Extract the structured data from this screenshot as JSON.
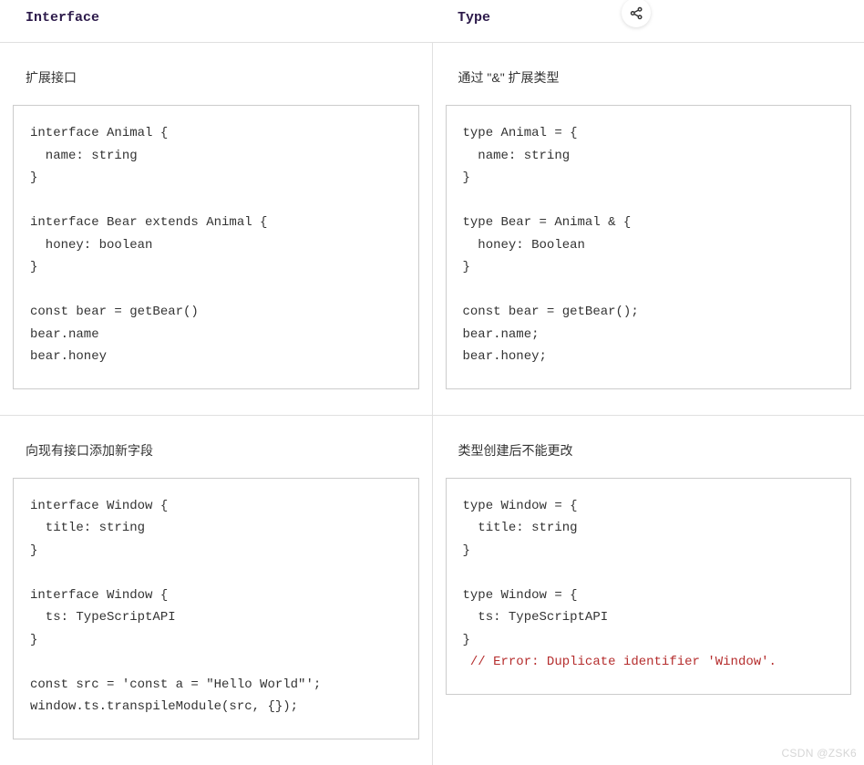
{
  "headers": {
    "left": "Interface",
    "right": "Type"
  },
  "row1": {
    "left": {
      "title": "扩展接口",
      "code": "interface Animal {\n  name: string\n}\n\ninterface Bear extends Animal {\n  honey: boolean\n}\n\nconst bear = getBear()\nbear.name\nbear.honey"
    },
    "right": {
      "title": "通过 \"&\" 扩展类型",
      "code": "type Animal = {\n  name: string\n}\n\ntype Bear = Animal & {\n  honey: Boolean\n}\n\nconst bear = getBear();\nbear.name;\nbear.honey;"
    }
  },
  "row2": {
    "left": {
      "title": "向现有接口添加新字段",
      "code": "interface Window {\n  title: string\n}\n\ninterface Window {\n  ts: TypeScriptAPI\n}\n\nconst src = 'const a = \"Hello World\"';\nwindow.ts.transpileModule(src, {});"
    },
    "right": {
      "title": "类型创建后不能更改",
      "code": "type Window = {\n  title: string\n}\n\ntype Window = {\n  ts: TypeScriptAPI\n}\n",
      "error": " // Error: Duplicate identifier 'Window'."
    }
  },
  "watermark": "CSDN @ZSK6"
}
